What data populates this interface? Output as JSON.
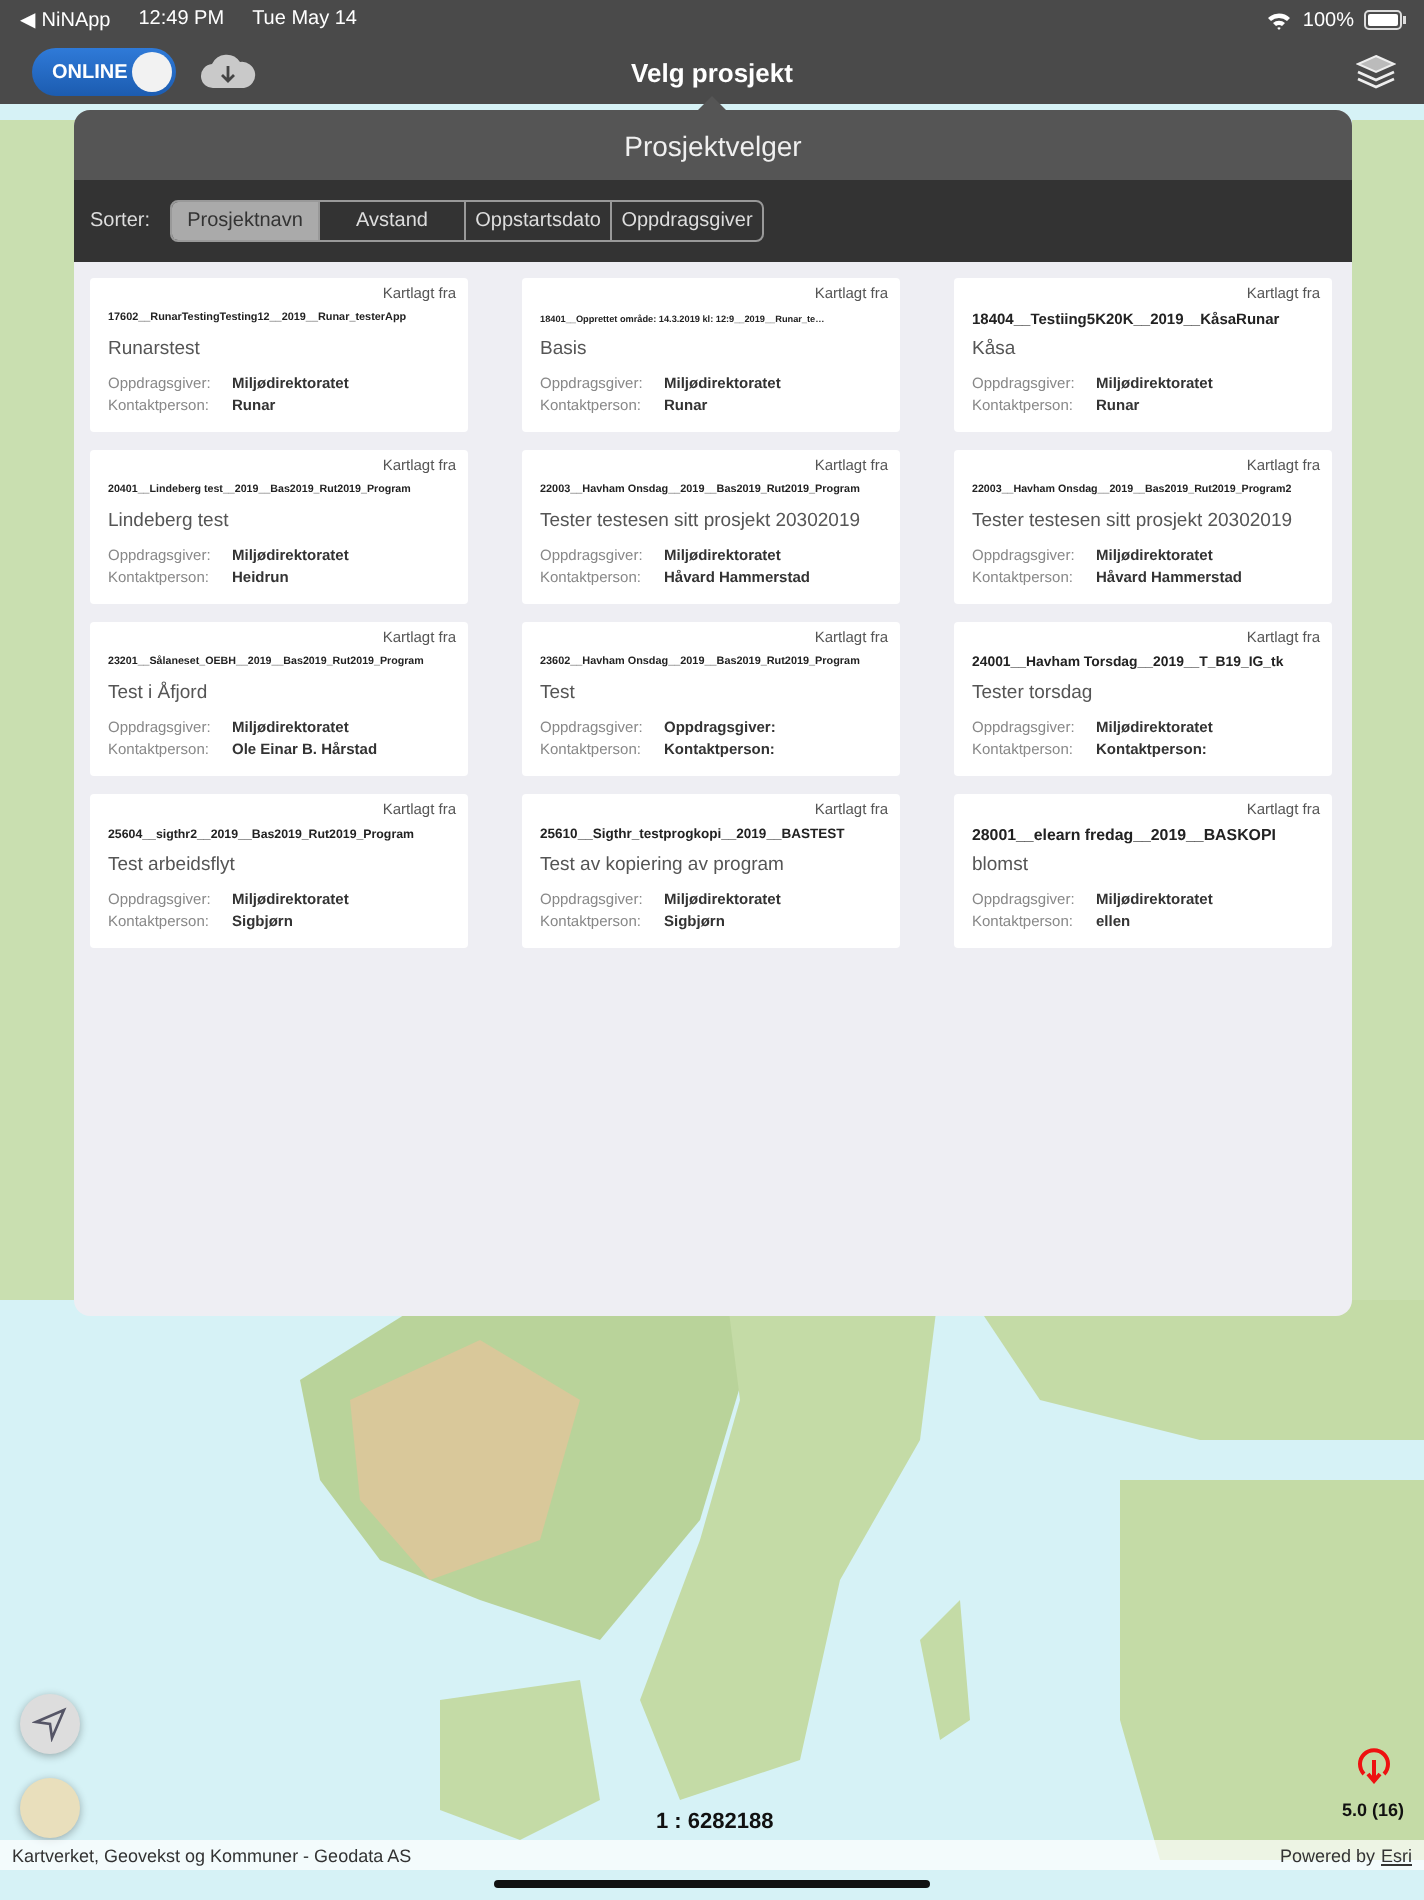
{
  "status_bar": {
    "back_app": "◀ NiNApp",
    "time": "12:49 PM",
    "date": "Tue May 14",
    "battery": "100%"
  },
  "nav_bar": {
    "online_toggle": {
      "label": "ONLINE",
      "on": true
    },
    "title": "Velg prosjekt"
  },
  "popover": {
    "title": "Prosjektvelger",
    "sort_label": "Sorter:",
    "sort_tabs": [
      {
        "label": "Prosjektnavn",
        "selected": true
      },
      {
        "label": "Avstand",
        "selected": false
      },
      {
        "label": "Oppstartsdato",
        "selected": false
      },
      {
        "label": "Oppdragsgiver",
        "selected": false
      }
    ],
    "projects": [
      {
        "mapped": "Kartlagt fra",
        "code": "17602__RunarTestingTesting12__2019__Runar_testerApp",
        "name": "Runarstest",
        "client_label": "Oppdragsgiver:",
        "client": "Miljødirektoratet",
        "contact_label": "Kontaktperson:",
        "contact": "Runar"
      },
      {
        "mapped": "Kartlagt fra",
        "code": "18401__Opprettet område: 14.3.2019 kl: 12:9__2019__Runar_te…",
        "name": "Basis",
        "client_label": "Oppdragsgiver:",
        "client": "Miljødirektoratet",
        "contact_label": "Kontaktperson:",
        "contact": "Runar"
      },
      {
        "mapped": "Kartlagt fra",
        "code": "18404__Testiing5K20K__2019__KåsaRunar",
        "name": "Kåsa",
        "client_label": "Oppdragsgiver:",
        "client": "Miljødirektoratet",
        "contact_label": "Kontaktperson:",
        "contact": "Runar"
      },
      {
        "mapped": "Kartlagt fra",
        "code": "20401__Lindeberg test__2019__Bas2019_Rut2019_Program",
        "name": "Lindeberg test",
        "client_label": "Oppdragsgiver:",
        "client": "Miljødirektoratet",
        "contact_label": "Kontaktperson:",
        "contact": "Heidrun"
      },
      {
        "mapped": "Kartlagt fra",
        "code": "22003__Havham Onsdag__2019__Bas2019_Rut2019_Program",
        "name": "Tester testesen sitt prosjekt 20302019",
        "client_label": "Oppdragsgiver:",
        "client": "Miljødirektoratet",
        "contact_label": "Kontaktperson:",
        "contact": "Håvard Hammerstad"
      },
      {
        "mapped": "Kartlagt fra",
        "code": "22003__Havham Onsdag__2019__Bas2019_Rut2019_Program2",
        "name": "Tester testesen sitt prosjekt 20302019",
        "client_label": "Oppdragsgiver:",
        "client": "Miljødirektoratet",
        "contact_label": "Kontaktperson:",
        "contact": "Håvard Hammerstad"
      },
      {
        "mapped": "Kartlagt fra",
        "code": "23201__Sålaneset_OEBH__2019__Bas2019_Rut2019_Program",
        "name": "Test i Åfjord",
        "client_label": "Oppdragsgiver:",
        "client": "Miljødirektoratet",
        "contact_label": "Kontaktperson:",
        "contact": "Ole Einar B. Hårstad"
      },
      {
        "mapped": "Kartlagt fra",
        "code": "23602__Havham Onsdag__2019__Bas2019_Rut2019_Program",
        "name": "Test",
        "client_label": "Oppdragsgiver:",
        "client": "Oppdragsgiver:",
        "contact_label": "Kontaktperson:",
        "contact": "Kontaktperson:"
      },
      {
        "mapped": "Kartlagt fra",
        "code": "24001__Havham Torsdag__2019__T_B19_IG_tk",
        "name": "Tester torsdag",
        "client_label": "Oppdragsgiver:",
        "client": "Miljødirektoratet",
        "contact_label": "Kontaktperson:",
        "contact": "Kontaktperson:"
      },
      {
        "mapped": "Kartlagt fra",
        "code": "25604__sigthr2__2019__Bas2019_Rut2019_Program",
        "name": "Test arbeidsflyt",
        "client_label": "Oppdragsgiver:",
        "client": "Miljødirektoratet",
        "contact_label": "Kontaktperson:",
        "contact": "Sigbjørn"
      },
      {
        "mapped": "Kartlagt fra",
        "code": "25610__Sigthr_testprogkopi__2019__BASTEST",
        "name": "Test av kopiering av program",
        "client_label": "Oppdragsgiver:",
        "client": "Miljødirektoratet",
        "contact_label": "Kontaktperson:",
        "contact": "Sigbjørn"
      },
      {
        "mapped": "Kartlagt fra",
        "code": "28001__elearn fredag__2019__BASKOPI",
        "name": "blomst",
        "client_label": "Oppdragsgiver:",
        "client": "Miljødirektoratet",
        "contact_label": "Kontaktperson:",
        "contact": "ellen"
      }
    ]
  },
  "map": {
    "scale": "1 : 6282188",
    "zoom_level": "5.0 (16)",
    "attribution": "Kartverket, Geovekst og Kommuner - Geodata AS",
    "powered_by": "Powered by",
    "esri_link": "Esri"
  }
}
